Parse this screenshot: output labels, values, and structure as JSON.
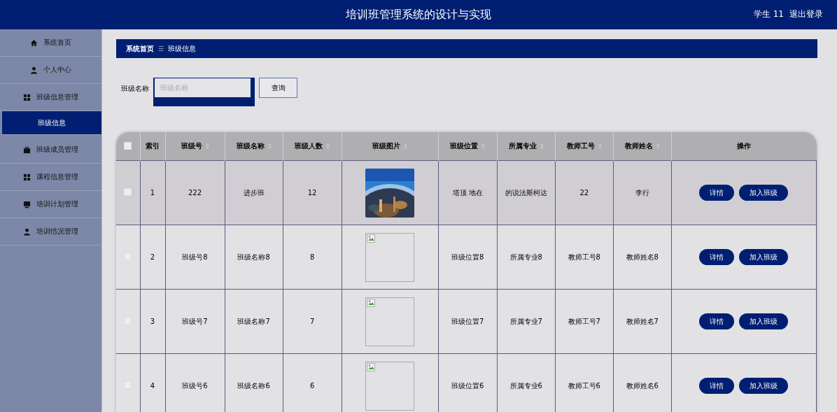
{
  "header": {
    "title": "培训班管理系统的设计与实现",
    "user": "学生 11",
    "logout": "退出登录"
  },
  "sidebar": {
    "items": [
      {
        "label": "系统首页",
        "selected": false
      },
      {
        "label": "个人中心",
        "selected": false
      },
      {
        "label": "班级信息管理",
        "selected": false,
        "expanded": true,
        "children": [
          {
            "label": "班级信息",
            "selected": true
          }
        ]
      },
      {
        "label": "班级成员管理",
        "selected": false
      },
      {
        "label": "课程信息管理",
        "selected": false
      },
      {
        "label": "培训计划管理",
        "selected": false
      },
      {
        "label": "培训情况管理",
        "selected": false
      }
    ]
  },
  "breadcrumb": {
    "items": [
      "系统首页",
      "班级信息"
    ],
    "separator": "☰"
  },
  "search": {
    "label": "班级名称",
    "placeholder": "班级名称",
    "button": "查询"
  },
  "table": {
    "columns": [
      {
        "kind": "checkbox",
        "checked": false
      },
      {
        "kind": "text",
        "label": "索引",
        "sortable": false
      },
      {
        "kind": "text",
        "label": "班级号",
        "sortable": true
      },
      {
        "kind": "text",
        "label": "班级名称",
        "sortable": true
      },
      {
        "kind": "text",
        "label": "班级人数",
        "sortable": true
      },
      {
        "kind": "text",
        "label": "班级图片",
        "sortable": true
      },
      {
        "kind": "text",
        "label": "班级位置",
        "sortable": true
      },
      {
        "kind": "text",
        "label": "所属专业",
        "sortable": true
      },
      {
        "kind": "text",
        "label": "教师工号",
        "sortable": true
      },
      {
        "kind": "text",
        "label": "教师姓名",
        "sortable": true
      },
      {
        "kind": "text",
        "label": "操作",
        "sortable": false
      }
    ],
    "rows": [
      {
        "highlighted": true,
        "cells": [
          {
            "kind": "checkbox",
            "checked": false
          },
          {
            "kind": "text",
            "text": "1"
          },
          {
            "kind": "text",
            "text": "222"
          },
          {
            "kind": "text",
            "text": "进步班"
          },
          {
            "kind": "text",
            "text": "12"
          },
          {
            "kind": "picture"
          },
          {
            "kind": "text",
            "text": "塔顶 地在"
          },
          {
            "kind": "text",
            "text": "的说法斯柯达"
          },
          {
            "kind": "text",
            "text": "22"
          },
          {
            "kind": "text",
            "text": "李行"
          },
          {
            "kind": "actions",
            "actions": [
              "详情",
              "加入班级"
            ]
          }
        ]
      },
      {
        "highlighted": false,
        "cells": [
          {
            "kind": "checkbox",
            "checked": false
          },
          {
            "kind": "text",
            "text": "2"
          },
          {
            "kind": "text",
            "text": "班级号8"
          },
          {
            "kind": "text",
            "text": "班级名称8"
          },
          {
            "kind": "text",
            "text": "8"
          },
          {
            "kind": "broken_image"
          },
          {
            "kind": "text",
            "text": "班级位置8"
          },
          {
            "kind": "text",
            "text": "所属专业8"
          },
          {
            "kind": "text",
            "text": "教师工号8"
          },
          {
            "kind": "text",
            "text": "教师姓名8"
          },
          {
            "kind": "actions",
            "actions": [
              "详情",
              "加入班级"
            ]
          }
        ]
      },
      {
        "highlighted": false,
        "cells": [
          {
            "kind": "checkbox",
            "checked": false
          },
          {
            "kind": "text",
            "text": "3"
          },
          {
            "kind": "text",
            "text": "班级号7"
          },
          {
            "kind": "text",
            "text": "班级名称7"
          },
          {
            "kind": "text",
            "text": "7"
          },
          {
            "kind": "broken_image"
          },
          {
            "kind": "text",
            "text": "班级位置7"
          },
          {
            "kind": "text",
            "text": "所属专业7"
          },
          {
            "kind": "text",
            "text": "教师工号7"
          },
          {
            "kind": "text",
            "text": "教师姓名7"
          },
          {
            "kind": "actions",
            "actions": [
              "详情",
              "加入班级"
            ]
          }
        ]
      },
      {
        "highlighted": false,
        "cells": [
          {
            "kind": "checkbox",
            "checked": false
          },
          {
            "kind": "text",
            "text": "4"
          },
          {
            "kind": "text",
            "text": "班级号6"
          },
          {
            "kind": "text",
            "text": "班级名称6"
          },
          {
            "kind": "text",
            "text": "6"
          },
          {
            "kind": "broken_image"
          },
          {
            "kind": "text",
            "text": "班级位置6"
          },
          {
            "kind": "text",
            "text": "所属专业6"
          },
          {
            "kind": "text",
            "text": "教师工号6"
          },
          {
            "kind": "text",
            "text": "教师姓名6"
          },
          {
            "kind": "actions",
            "actions": [
              "详情",
              "加入班级"
            ]
          }
        ]
      }
    ]
  }
}
